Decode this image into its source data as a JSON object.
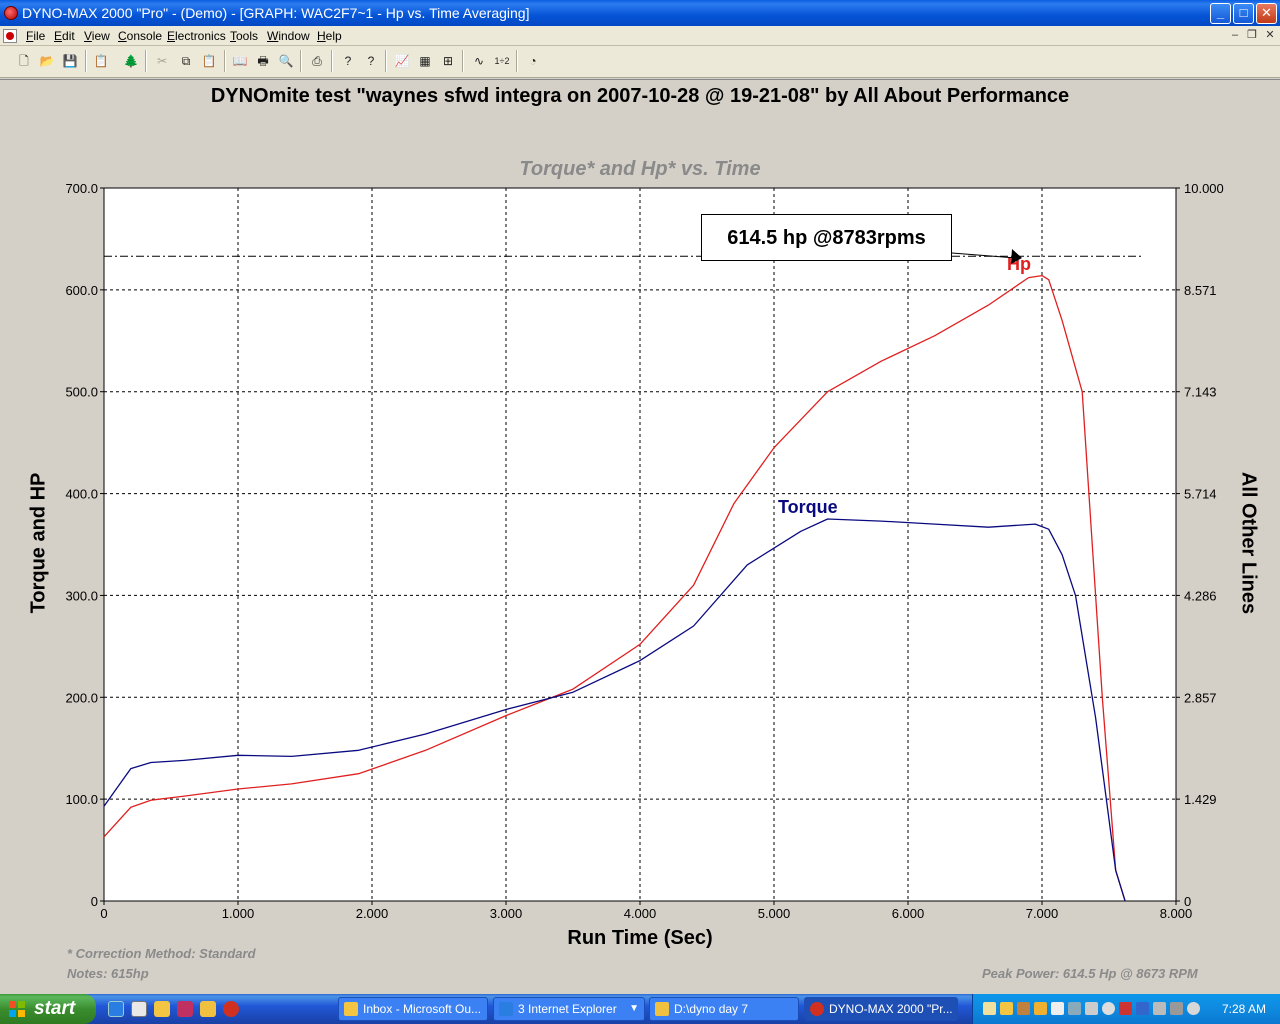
{
  "window": {
    "title": "DYNO-MAX 2000 \"Pro\" - (Demo) - [GRAPH: WAC2F7~1 - Hp vs. Time Averaging]",
    "controls": {
      "minimize": "_",
      "maximize": "□",
      "close": "✕"
    }
  },
  "menu": {
    "items": [
      "File",
      "Edit",
      "View",
      "Console",
      "Electronics",
      "Tools",
      "Window",
      "Help"
    ],
    "mdi": {
      "minimize": "–",
      "restore": "❐",
      "close": "✕"
    }
  },
  "toolbar": {
    "buttons": [
      {
        "name": "new-icon",
        "glyph": "🗋"
      },
      {
        "name": "open-icon",
        "glyph": "📂"
      },
      {
        "name": "save-icon",
        "glyph": "💾"
      },
      {
        "name": "clipboard-icon",
        "glyph": "📋"
      },
      {
        "name": "tree-icon",
        "glyph": "🌲"
      },
      {
        "name": "cut-icon",
        "glyph": "✂"
      },
      {
        "name": "copy-icon",
        "glyph": "⧉"
      },
      {
        "name": "paste-icon",
        "glyph": "📋"
      },
      {
        "name": "book-icon",
        "glyph": "📖"
      },
      {
        "name": "print-icon",
        "glyph": "🖶"
      },
      {
        "name": "print-preview-icon",
        "glyph": "🔍"
      },
      {
        "name": "run-icon",
        "glyph": "⎙"
      },
      {
        "name": "help-icon",
        "glyph": "?"
      },
      {
        "name": "context-help-icon",
        "glyph": "?"
      },
      {
        "name": "graph-icon",
        "glyph": "📈"
      },
      {
        "name": "table-icon",
        "glyph": "▦"
      },
      {
        "name": "grid-icon",
        "glyph": "⊞"
      },
      {
        "name": "waveform-icon",
        "glyph": "∿"
      },
      {
        "name": "ratio-icon",
        "glyph": "1÷2"
      },
      {
        "name": "gauge-icon",
        "glyph": "◔"
      }
    ]
  },
  "graph": {
    "header": "DYNOmite test \"waynes sfwd integra on 2007-10-28 @ 19-21-08\" by All About Performance",
    "peak_annotation": "614.5 hp @8783rpms",
    "footnote_correction": "* Correction Method: Standard",
    "footnote_notes": "Notes: 615hp",
    "footnote_peak": "Peak Power: 614.5 Hp @ 8673 RPM"
  },
  "chart_data": {
    "type": "line",
    "title": "Torque* and Hp* vs. Time",
    "xlabel": "Run Time (Sec)",
    "ylabel": "Torque and HP",
    "ylabel_right": "All Other Lines",
    "xlim": [
      0,
      8
    ],
    "ylim": [
      0,
      700
    ],
    "ylim_right": [
      0,
      10
    ],
    "x_ticks": [
      "0",
      "1.000",
      "2.000",
      "3.000",
      "4.000",
      "5.000",
      "6.000",
      "7.000",
      "8.000"
    ],
    "y_ticks": [
      "0",
      "100.0",
      "200.0",
      "300.0",
      "400.0",
      "500.0",
      "600.0",
      "700.0"
    ],
    "y_right_ticks": [
      "0",
      "1.429",
      "2.857",
      "4.286",
      "5.714",
      "7.143",
      "8.571",
      "10.000"
    ],
    "grid": true,
    "peak_line_y": 633,
    "series": [
      {
        "name": "Hp",
        "color": "#e02020",
        "x": [
          0,
          0.2,
          0.35,
          0.6,
          1.0,
          1.4,
          1.9,
          2.4,
          3.0,
          3.5,
          4.0,
          4.4,
          4.7,
          5.0,
          5.4,
          5.8,
          6.2,
          6.6,
          6.9,
          7.0,
          7.05,
          7.15,
          7.3,
          7.45,
          7.55,
          7.62
        ],
        "values": [
          63,
          92,
          99,
          103,
          110,
          115,
          125,
          148,
          182,
          208,
          252,
          310,
          390,
          445,
          500,
          530,
          555,
          585,
          612,
          614,
          610,
          570,
          500,
          200,
          30,
          0
        ]
      },
      {
        "name": "Torque",
        "color": "#0a0a80",
        "x": [
          0,
          0.2,
          0.35,
          0.6,
          1.0,
          1.4,
          1.9,
          2.4,
          3.0,
          3.5,
          4.0,
          4.4,
          4.8,
          5.2,
          5.4,
          5.8,
          6.2,
          6.6,
          6.95,
          7.05,
          7.15,
          7.25,
          7.4,
          7.55,
          7.62
        ],
        "values": [
          93,
          130,
          136,
          138,
          143,
          142,
          148,
          164,
          188,
          205,
          236,
          270,
          330,
          363,
          375,
          373,
          370,
          367,
          370,
          365,
          340,
          300,
          180,
          30,
          0
        ]
      }
    ],
    "series_labels": [
      "Hp",
      "Torque"
    ]
  },
  "taskbar": {
    "start": "start",
    "tasks": [
      {
        "label": "Inbox - Microsoft Ou...",
        "active": false
      },
      {
        "label": "3 Internet Explorer",
        "active": false
      },
      {
        "label": "D:\\dyno day 7",
        "active": false
      },
      {
        "label": "DYNO-MAX 2000 \"Pr...",
        "active": true
      }
    ],
    "clock": "7:28 AM"
  }
}
